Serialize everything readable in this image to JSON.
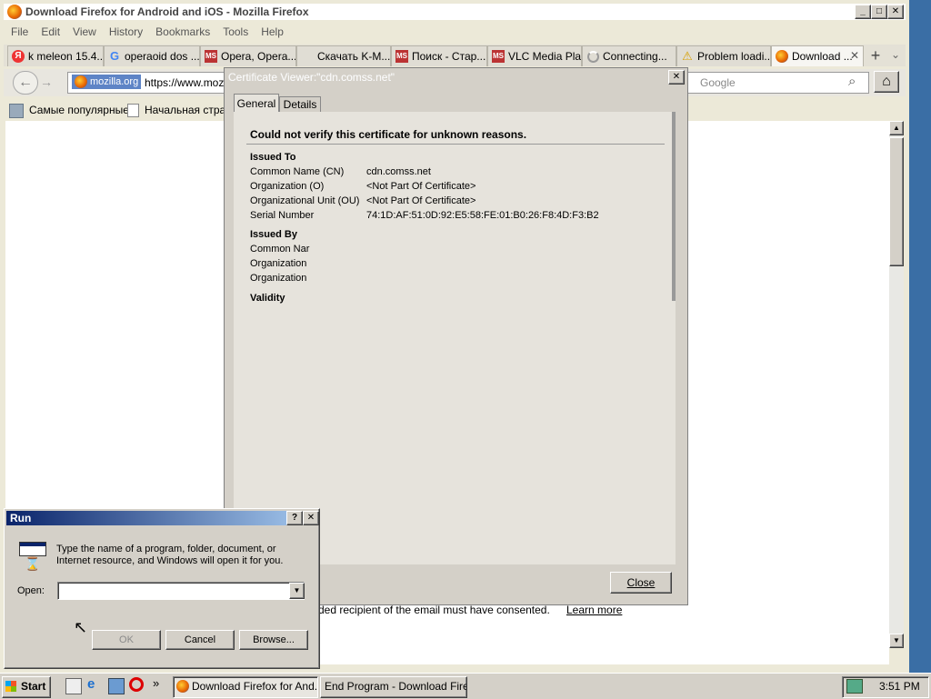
{
  "window": {
    "title": "Download Firefox for Android and iOS - Mozilla Firefox"
  },
  "menu": [
    "File",
    "Edit",
    "View",
    "History",
    "Bookmarks",
    "Tools",
    "Help"
  ],
  "tabs": [
    {
      "label": "k meleon 15.4...",
      "icon": "yandex-icon"
    },
    {
      "label": "operaoid dos ...",
      "icon": "google-icon"
    },
    {
      "label": "Opera, Opera...",
      "icon": "ms-icon"
    },
    {
      "label": "Скачать K-M...",
      "icon": "blank-icon"
    },
    {
      "label": "Поиск - Стар...",
      "icon": "ms-icon"
    },
    {
      "label": "VLC Media Pla...",
      "icon": "ms-icon"
    },
    {
      "label": "Connecting...",
      "icon": "loading-icon"
    },
    {
      "label": "Problem loadi...",
      "icon": "warning-icon"
    },
    {
      "label": "Download ...",
      "icon": "firefox-icon"
    }
  ],
  "navbar": {
    "identity": "mozilla.org",
    "url": "https://www.mozil",
    "search_placeholder": "Google"
  },
  "bookmarks": [
    "Самые популярные",
    "Начальная стран"
  ],
  "page": {
    "footer_text": "ded recipient of the email must have consented.",
    "learn_more": "Learn more"
  },
  "cert": {
    "title": "Certificate Viewer:\"cdn.comss.net\"",
    "tabs": [
      "General",
      "Details"
    ],
    "warning": "Could not verify this certificate for unknown reasons.",
    "issued_to_heading": "Issued To",
    "issued_to": [
      {
        "label": "Common Name (CN)",
        "value": "cdn.comss.net"
      },
      {
        "label": "Organization (O)",
        "value": "<Not Part Of Certificate>"
      },
      {
        "label": "Organizational Unit (OU)",
        "value": "<Not Part Of Certificate>"
      },
      {
        "label": "Serial Number",
        "value": "74:1D:AF:51:0D:92:E5:58:FE:01:B0:26:F8:4D:F3:B2"
      }
    ],
    "issued_by_heading": "Issued By",
    "issued_by": [
      "Common Nar",
      "Organization",
      "Organization"
    ],
    "validity_heading": "Validity",
    "close_label": "Close"
  },
  "run": {
    "title": "Run",
    "help": "?",
    "description": "Type the name of a program, folder, document, or Internet resource, and Windows will open it for you.",
    "open_label": "Open:",
    "open_value": "",
    "ok": "OK",
    "cancel": "Cancel",
    "browse": "Browse..."
  },
  "taskbar": {
    "start": "Start",
    "tasks": [
      "Download Firefox for And...",
      "End Program - Download Fire..."
    ],
    "clock": "3:51 PM"
  }
}
